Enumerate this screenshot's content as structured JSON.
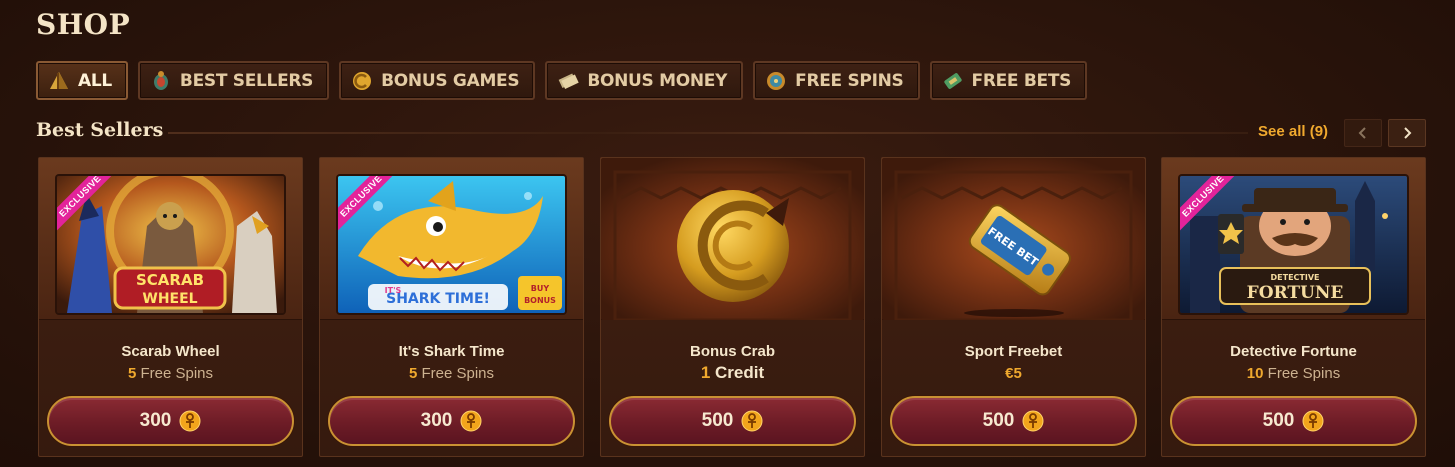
{
  "page": {
    "title": "SHOP"
  },
  "tabs": [
    {
      "label": "ALL",
      "icon": "pyramid-icon",
      "active": true
    },
    {
      "label": "BEST SELLERS",
      "icon": "beetle-icon",
      "active": false
    },
    {
      "label": "BONUS GAMES",
      "icon": "coin-icon",
      "active": false
    },
    {
      "label": "BONUS MONEY",
      "icon": "money-icon",
      "active": false
    },
    {
      "label": "FREE SPINS",
      "icon": "spin-icon",
      "active": false
    },
    {
      "label": "FREE BETS",
      "icon": "ticket-icon",
      "active": false
    }
  ],
  "section": {
    "title": "Best Sellers",
    "see_all": "See all (9)",
    "prev_icon": "chevron-left-icon",
    "next_icon": "chevron-right-icon"
  },
  "cards": [
    {
      "name": "Scarab Wheel",
      "quantity": "5",
      "unit": "Free Spins",
      "price": "300",
      "badge": "EXCLUSIVE",
      "image": "SCARAB WHEEL"
    },
    {
      "name": "It's Shark Time",
      "quantity": "5",
      "unit": "Free Spins",
      "price": "300",
      "badge": "EXCLUSIVE",
      "image": "IT'S SHARK TIME!"
    },
    {
      "name": "Bonus Crab",
      "quantity": "1",
      "unit": "Credit",
      "price": "500",
      "badge": "",
      "image": ""
    },
    {
      "name": "Sport Freebet",
      "quantity": "€5",
      "unit": "",
      "price": "500",
      "badge": "",
      "image": "FREE BET"
    },
    {
      "name": "Detective Fortune",
      "quantity": "10",
      "unit": "Free Spins",
      "price": "500",
      "badge": "EXCLUSIVE",
      "image": "DETECTIVE FORTUNE"
    }
  ],
  "colors": {
    "accent": "#f0a92e",
    "button": "#7a2330",
    "badge": "#e3239a"
  }
}
